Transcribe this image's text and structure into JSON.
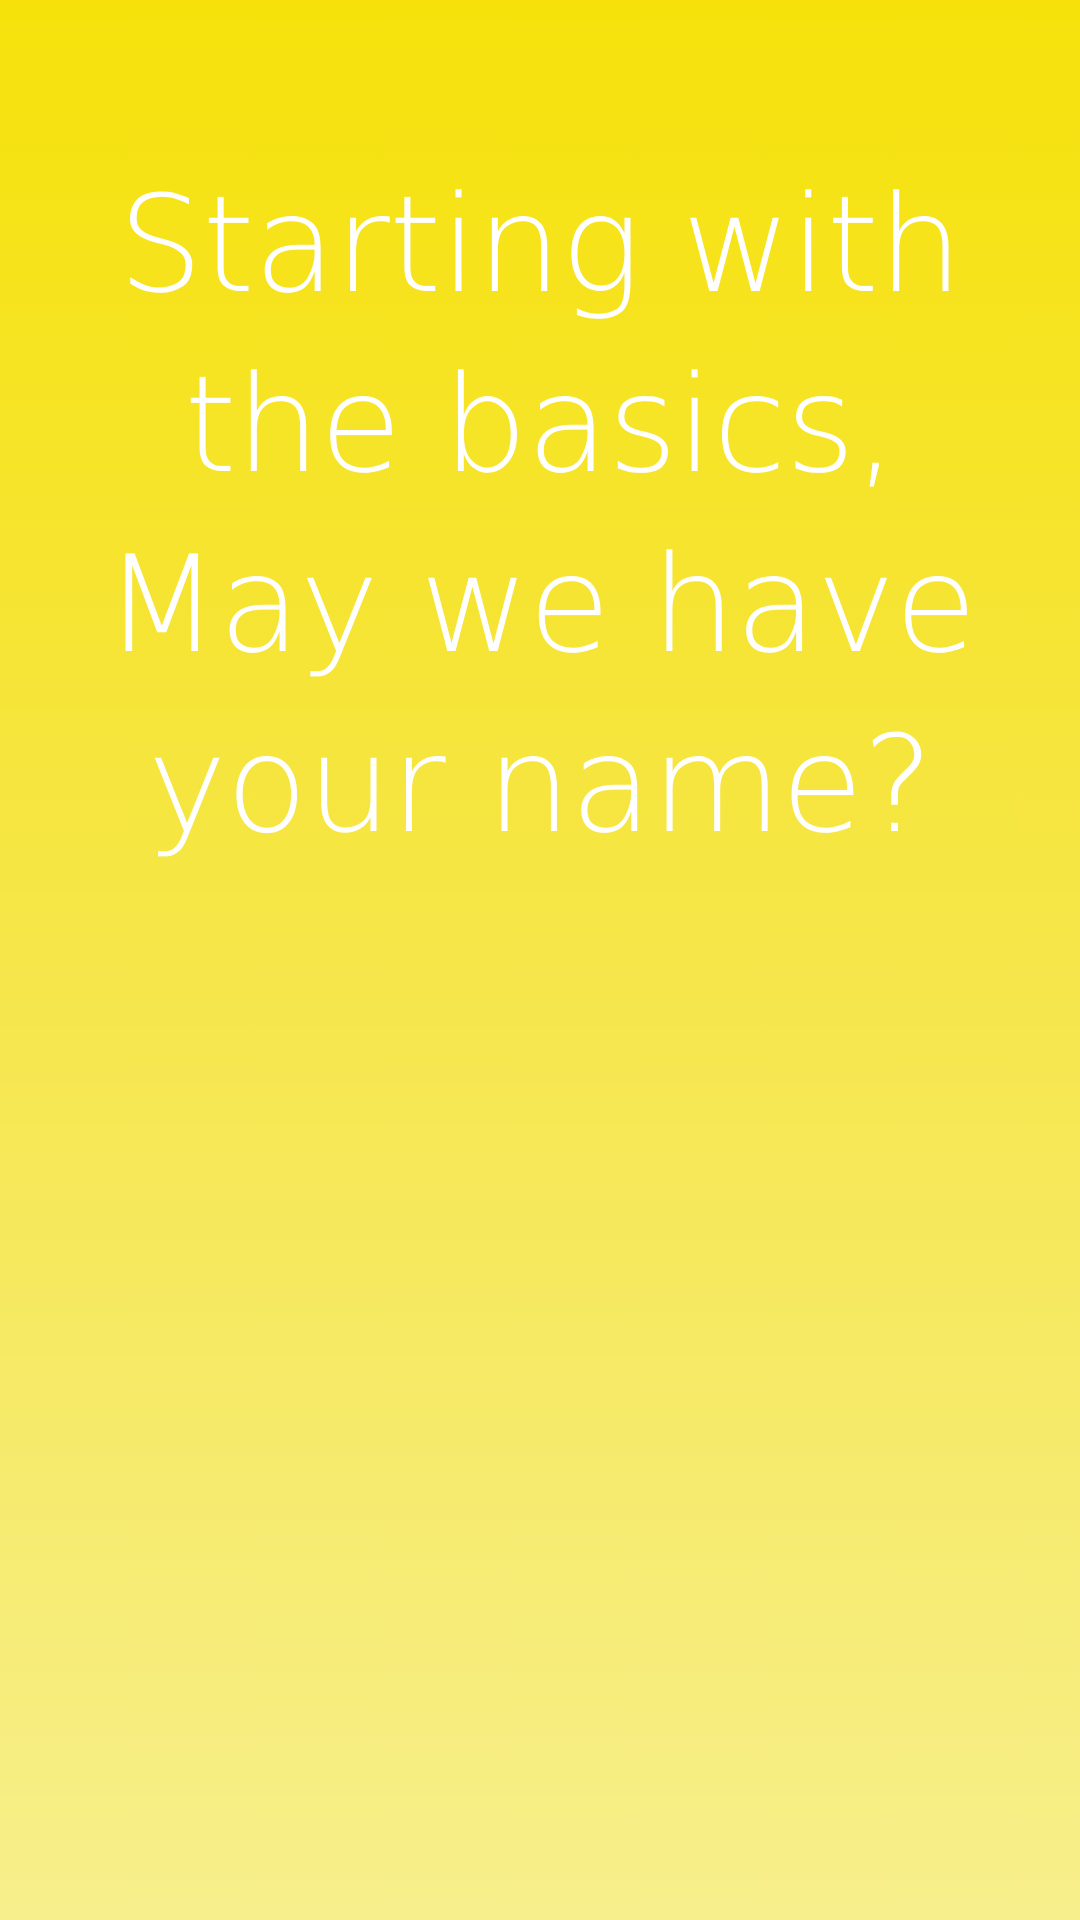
{
  "prompt": {
    "lines": [
      "Starting with",
      "the basics,",
      "May we have",
      "your name?"
    ]
  },
  "colors": {
    "background_top": "#F6E20A",
    "background_bottom": "#F7EF8C",
    "text": "#FFFFFF"
  }
}
